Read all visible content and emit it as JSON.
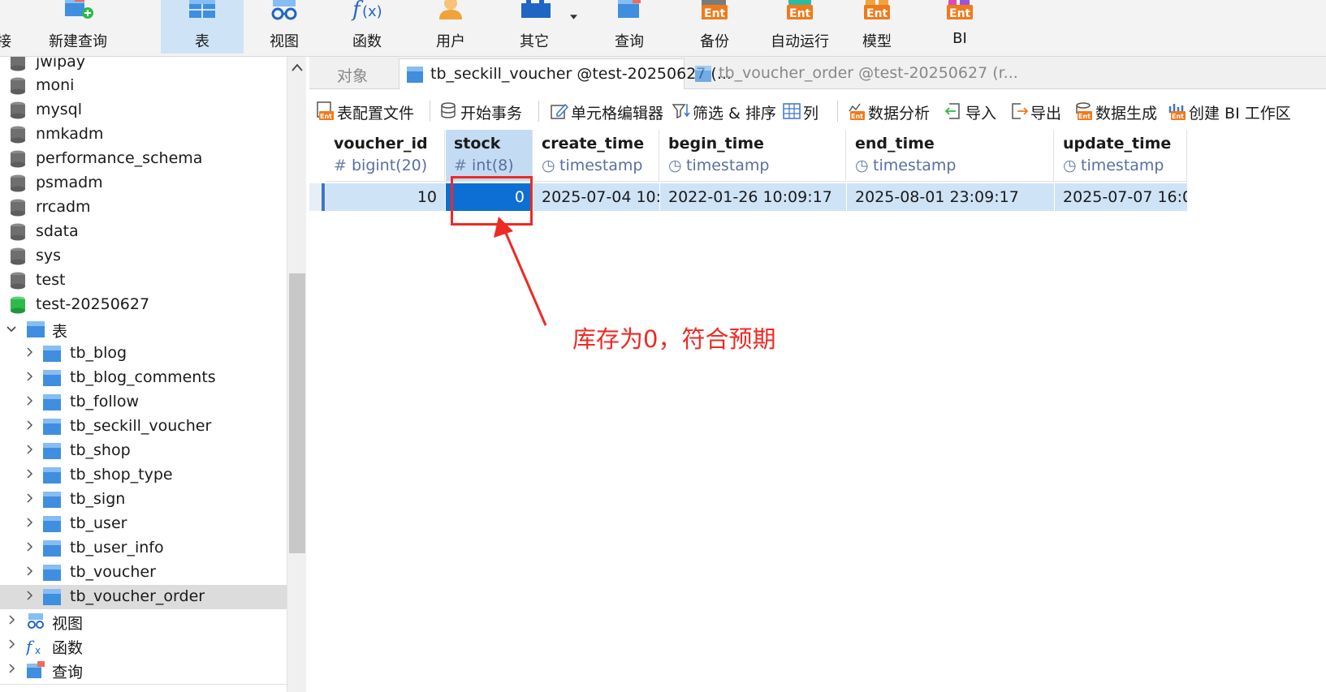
{
  "ribbon": {
    "items": [
      {
        "label": "接",
        "icon": "connection-icon"
      },
      {
        "label": "新建查询",
        "icon": "new-query-icon"
      },
      {
        "label": "表",
        "icon": "table-icon",
        "active": true
      },
      {
        "label": "视图",
        "icon": "view-icon"
      },
      {
        "label": "函数",
        "icon": "function-icon"
      },
      {
        "label": "用户",
        "icon": "user-icon"
      },
      {
        "label": "其它",
        "icon": "other-icon"
      },
      {
        "label": "查询",
        "icon": "query-icon"
      },
      {
        "label": "备份",
        "icon": "backup-icon"
      },
      {
        "label": "自动运行",
        "icon": "auto-run-icon"
      },
      {
        "label": "模型",
        "icon": "model-icon"
      },
      {
        "label": "BI",
        "icon": "bi-icon"
      }
    ],
    "ent_badge": "Ent"
  },
  "tree": {
    "databases": [
      "jwipay",
      "moni",
      "mysql",
      "nmkadm",
      "performance_schema",
      "psmadm",
      "rrcadm",
      "sdata",
      "sys",
      "test",
      "test-20250627"
    ],
    "tables_group": "表",
    "tables": [
      "tb_blog",
      "tb_blog_comments",
      "tb_follow",
      "tb_seckill_voucher",
      "tb_shop",
      "tb_shop_type",
      "tb_sign",
      "tb_user",
      "tb_user_info",
      "tb_voucher",
      "tb_voucher_order"
    ],
    "selected_table": "tb_voucher_order",
    "groups": [
      "视图",
      "函数",
      "查询"
    ]
  },
  "tabs": [
    {
      "label": "对象"
    },
    {
      "label": "tb_seckill_voucher @test-20250627 (..."
    },
    {
      "label": "tb_voucher_order @test-20250627 (r..."
    }
  ],
  "toolbar": [
    {
      "label": "表配置文件",
      "icon": "table-profile-icon"
    },
    {
      "label": "开始事务",
      "icon": "begin-transaction-icon"
    },
    {
      "label": "单元格编辑器",
      "icon": "cell-editor-icon"
    },
    {
      "label": "筛选 & 排序",
      "icon": "filter-sort-icon"
    },
    {
      "label": "列",
      "icon": "columns-icon"
    },
    {
      "label": "数据分析",
      "icon": "data-analysis-icon"
    },
    {
      "label": "导入",
      "icon": "import-icon"
    },
    {
      "label": "导出",
      "icon": "export-icon"
    },
    {
      "label": "数据生成",
      "icon": "data-generation-icon"
    },
    {
      "label": "创建 BI 工作区",
      "icon": "create-bi-workspace-icon"
    }
  ],
  "grid": {
    "columns": [
      {
        "name": "voucher_id",
        "type": "bigint(20)",
        "type_icon": "#"
      },
      {
        "name": "stock",
        "type": "int(8)",
        "type_icon": "#"
      },
      {
        "name": "create_time",
        "type": "timestamp",
        "type_icon": "◷"
      },
      {
        "name": "begin_time",
        "type": "timestamp",
        "type_icon": "◷"
      },
      {
        "name": "end_time",
        "type": "timestamp",
        "type_icon": "◷"
      },
      {
        "name": "update_time",
        "type": "timestamp",
        "type_icon": "◷"
      }
    ],
    "rows": [
      [
        "10",
        "0",
        "2025-07-04 10:",
        "2022-01-26 10:09:17",
        "2025-08-01 23:09:17",
        "2025-07-07 16:0"
      ]
    ]
  },
  "annotation": {
    "text": "库存为0，符合预期",
    "color": "#ee2a24"
  },
  "colors": {
    "accent": "#0d6fd4",
    "selection": "#cfe3f7",
    "annotation": "#ee2a24"
  }
}
